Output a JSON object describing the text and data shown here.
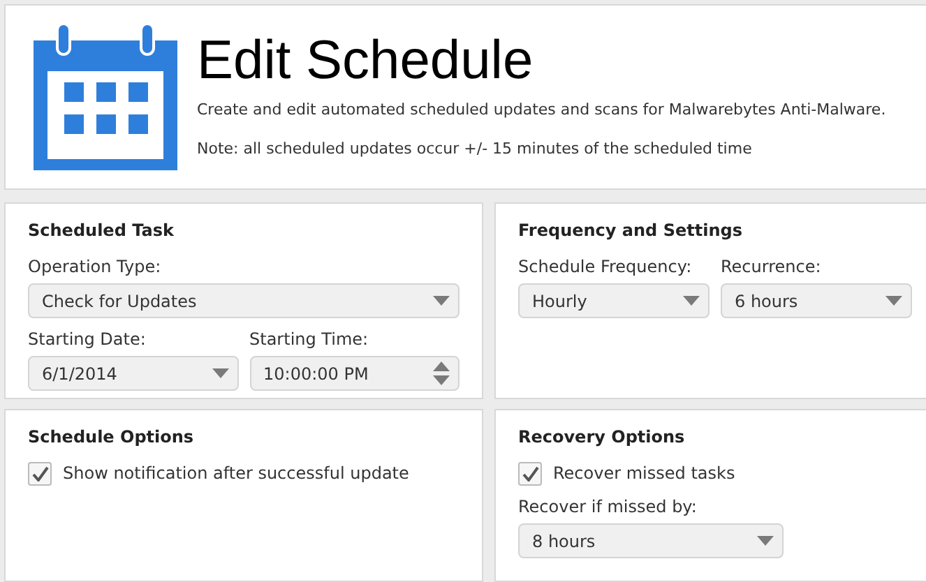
{
  "header": {
    "title": "Edit Schedule",
    "description": "Create and edit automated scheduled updates and scans for Malwarebytes Anti-Malware.",
    "note": "Note: all scheduled updates occur +/- 15 minutes of the scheduled time"
  },
  "panels": [
    {
      "title": "Scheduled Task",
      "rows": [
        [
          {
            "kind": "dropdown",
            "label": "Operation Type:",
            "value": "Check for Updates"
          }
        ],
        [
          {
            "kind": "dropdown",
            "label": "Starting Date:",
            "value": "6/1/2014"
          },
          {
            "kind": "spinner",
            "label": "Starting Time:",
            "value": "10:00:00 PM"
          }
        ]
      ]
    },
    {
      "title": "Frequency and Settings",
      "rows": [
        [
          {
            "kind": "dropdown",
            "label": "Schedule Frequency:",
            "value": "Hourly"
          },
          {
            "kind": "dropdown",
            "label": "Recurrence:",
            "value": "6 hours"
          }
        ]
      ]
    },
    {
      "title": "Schedule Options",
      "rows": [
        [
          {
            "kind": "checkbox",
            "label": "Show notification after successful update",
            "checked": true
          }
        ]
      ]
    },
    {
      "title": "Recovery Options",
      "rows": [
        [
          {
            "kind": "checkbox",
            "label": "Recover missed tasks",
            "checked": true
          }
        ],
        [
          {
            "kind": "dropdown",
            "label": "Recover if missed by:",
            "value": "8 hours"
          }
        ]
      ]
    }
  ]
}
